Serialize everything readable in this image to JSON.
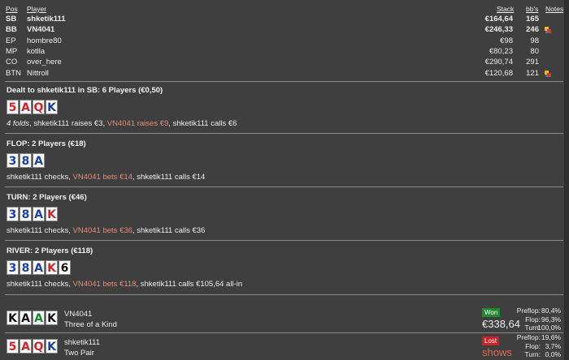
{
  "header": {
    "pos": "Pos",
    "player": "Player",
    "stack": "Stack",
    "bbs": "bb's",
    "notes": "Notes"
  },
  "players": [
    {
      "pos": "SB",
      "name": "shketik111",
      "stack": "€164,64",
      "bbs": "165",
      "bold": true,
      "flag": false
    },
    {
      "pos": "BB",
      "name": "VN4041",
      "stack": "€246,33",
      "bbs": "246",
      "bold": true,
      "flag": true
    },
    {
      "pos": "EP",
      "name": "hombre80",
      "stack": "€98",
      "bbs": "98",
      "bold": false,
      "flag": false
    },
    {
      "pos": "MP",
      "name": "kotlla",
      "stack": "€80,23",
      "bbs": "80",
      "bold": false,
      "flag": false
    },
    {
      "pos": "CO",
      "name": "over_here",
      "stack": "€290,74",
      "bbs": "291",
      "bold": false,
      "flag": false
    },
    {
      "pos": "BTN",
      "name": "Nittroll",
      "stack": "€120,68",
      "bbs": "121",
      "bold": false,
      "flag": true
    }
  ],
  "preflop": {
    "title": "Dealt to shketik111 in SB: 6 Players (€0,50)",
    "cards": [
      {
        "r": "5",
        "c": "red"
      },
      {
        "r": "A",
        "c": "red"
      },
      {
        "r": "Q",
        "c": "red"
      },
      {
        "r": "K",
        "c": "blue"
      }
    ],
    "a1": "4 folds",
    "a2": ", shketik111 raises €3, ",
    "a3": "VN4041 raises €9",
    "a4": ", shketik111 calls €6"
  },
  "flop": {
    "title": "FLOP: 2 Players (€18)",
    "cards": [
      {
        "r": "3",
        "c": "blue"
      },
      {
        "r": "8",
        "c": "blue"
      },
      {
        "r": "A",
        "c": "blue"
      }
    ],
    "a1": "shketik111 checks, ",
    "a2": "VN4041 bets €14",
    "a3": ", shketik111 calls €14"
  },
  "turn": {
    "title": "TURN: 2 Players (€46)",
    "cards": [
      {
        "r": "3",
        "c": "blue"
      },
      {
        "r": "8",
        "c": "blue"
      },
      {
        "r": "A",
        "c": "blue"
      },
      {
        "r": "K",
        "c": "red"
      }
    ],
    "a1": "shketik111 checks, ",
    "a2": "VN4041 bets €36",
    "a3": ", shketik111 calls €36"
  },
  "river": {
    "title": "RIVER: 2 Players (€118)",
    "cards": [
      {
        "r": "3",
        "c": "blue"
      },
      {
        "r": "8",
        "c": "blue"
      },
      {
        "r": "A",
        "c": "blue"
      },
      {
        "r": "K",
        "c": "red"
      },
      {
        "r": "6",
        "c": "black"
      }
    ],
    "a1": "shketik111 checks, ",
    "a2": "VN4041 bets €118",
    "a3": ", shketik111 calls €105,64 all-in"
  },
  "results": [
    {
      "cards": [
        {
          "r": "K",
          "c": "black"
        },
        {
          "r": "A",
          "c": "black"
        },
        {
          "r": "A",
          "c": "green"
        },
        {
          "r": "K",
          "c": "black"
        }
      ],
      "name": "VN4041",
      "hand": "Three of a Kind",
      "badge": "Won",
      "amount": "€338,64",
      "outcome": "won",
      "stats": [
        {
          "l": "Preflop:",
          "v": "80,4%"
        },
        {
          "l": "Flop:",
          "v": "96,3%"
        },
        {
          "l": "Turn:",
          "v": "100,0%"
        }
      ]
    },
    {
      "cards": [
        {
          "r": "5",
          "c": "red"
        },
        {
          "r": "A",
          "c": "red"
        },
        {
          "r": "Q",
          "c": "red"
        },
        {
          "r": "K",
          "c": "blue"
        }
      ],
      "name": "shketik111",
      "hand": "Two Pair",
      "badge": "Lost",
      "amount": "shows",
      "outcome": "lost",
      "stats": [
        {
          "l": "Preflop:",
          "v": "19,6%"
        },
        {
          "l": "Flop:",
          "v": "3,7%"
        },
        {
          "l": "Turn:",
          "v": "0,0%"
        }
      ]
    }
  ],
  "colors": {
    "bg": "#3f3f3f",
    "bet": "#e38d7a",
    "won": "#1d8a2d",
    "lost": "#c8232b",
    "shows": "#e06a55"
  }
}
